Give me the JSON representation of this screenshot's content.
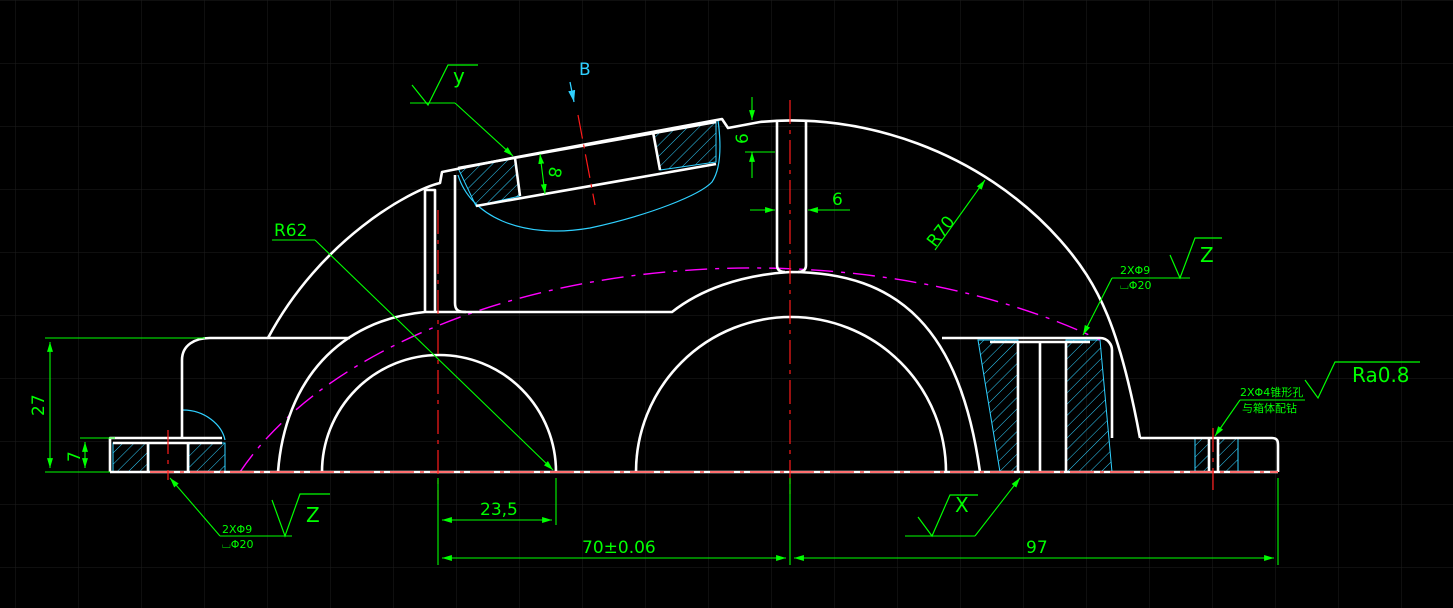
{
  "colors": {
    "background": "#000000",
    "grid": "#1e1e1e",
    "outline": "#ffffff",
    "dimension": "#00ff00",
    "centerline": "#ff1a1a",
    "hatch": "#2fd0ff",
    "pitch_circle": "#ff00ff"
  },
  "annotations": {
    "radius_62": "R62",
    "radius_70": "R70",
    "datum_b": "B",
    "finish_y": "y",
    "finish_z_left": "Z",
    "finish_z_right": "Z",
    "finish_x": "X",
    "roughness": "Ra0.8",
    "hole_left_line1": "2XΦ9",
    "hole_left_line2": "⌴Φ20",
    "hole_right_line1": "2XΦ9",
    "hole_right_line2": "⌴Φ20",
    "pin_note_line1": "2XΦ4锥形孔",
    "pin_note_line2": "与箱体配钻"
  },
  "dimensions": {
    "width_23_5": "23,5",
    "width_70": "70±0.06",
    "width_97": "97",
    "height_27": "27",
    "height_7": "7",
    "slot_8": "8",
    "rib_6": "6",
    "top_6": "6"
  }
}
